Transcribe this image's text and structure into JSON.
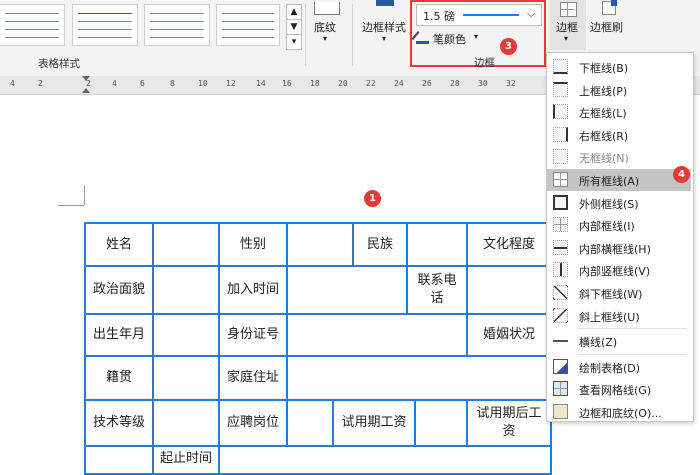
{
  "ribbon": {
    "table_styles_label": "表格样式",
    "shading_label": "底纹",
    "border_styles_label": "边框样式",
    "pen_weight_value": "1.5 磅",
    "pen_color_label": "笔颜色",
    "borders_group_label": "边框",
    "borders_button_label": "边框",
    "border_painter_label": "边框刷"
  },
  "ruler": {
    "ticks": [
      "4",
      "2",
      "2",
      "4",
      "6",
      "8",
      "10",
      "12",
      "14",
      "16",
      "18",
      "20",
      "22",
      "24",
      "26",
      "28",
      "30",
      "32"
    ]
  },
  "callouts": {
    "table": "1",
    "pen_group": "3",
    "all_borders": "4"
  },
  "table": {
    "row1": {
      "name": "姓名",
      "gender": "性别",
      "ethnicity": "民族",
      "education": "文化程度"
    },
    "row2": {
      "political": "政治面貌",
      "join_time": "加入时间",
      "contact": "联系电话"
    },
    "row3": {
      "birth": "出生年月",
      "id_number": "身份证号",
      "marital": "婚姻状况"
    },
    "row4": {
      "native_place": "籍贯",
      "address": "家庭住址"
    },
    "row5": {
      "skill_level": "技术等级",
      "position": "应聘岗位",
      "probation_salary": "试用期工资",
      "post_probation_salary": "试用期后工资"
    },
    "row6": {
      "start_end_time": "起止时间"
    }
  },
  "border_menu": {
    "items": [
      {
        "label": "下框线(B)",
        "icon": "bottom-border-icon"
      },
      {
        "label": "上框线(P)",
        "icon": "top-border-icon"
      },
      {
        "label": "左框线(L)",
        "icon": "left-border-icon"
      },
      {
        "label": "右框线(R)",
        "icon": "right-border-icon"
      },
      {
        "label": "无框线(N)",
        "icon": "no-border-icon"
      },
      {
        "label": "所有框线(A)",
        "icon": "all-borders-icon"
      },
      {
        "label": "外侧框线(S)",
        "icon": "outside-borders-icon"
      },
      {
        "label": "内部框线(I)",
        "icon": "inside-borders-icon"
      },
      {
        "label": "内部横框线(H)",
        "icon": "inside-horizontal-border-icon"
      },
      {
        "label": "内部竖框线(V)",
        "icon": "inside-vertical-border-icon"
      },
      {
        "label": "斜下框线(W)",
        "icon": "diagonal-down-border-icon"
      },
      {
        "label": "斜上框线(U)",
        "icon": "diagonal-up-border-icon"
      },
      {
        "label": "横线(Z)",
        "icon": "horizontal-line-icon"
      },
      {
        "label": "绘制表格(D)",
        "icon": "draw-table-icon"
      },
      {
        "label": "查看网格线(G)",
        "icon": "view-gridlines-icon"
      },
      {
        "label": "边框和底纹(O)...",
        "icon": "borders-and-shading-icon"
      }
    ]
  },
  "colors": {
    "table_border": "#2a7bd4",
    "callout": "#e53935",
    "highlight_box": "#e53935",
    "selected_item": "#c5c5c5"
  }
}
